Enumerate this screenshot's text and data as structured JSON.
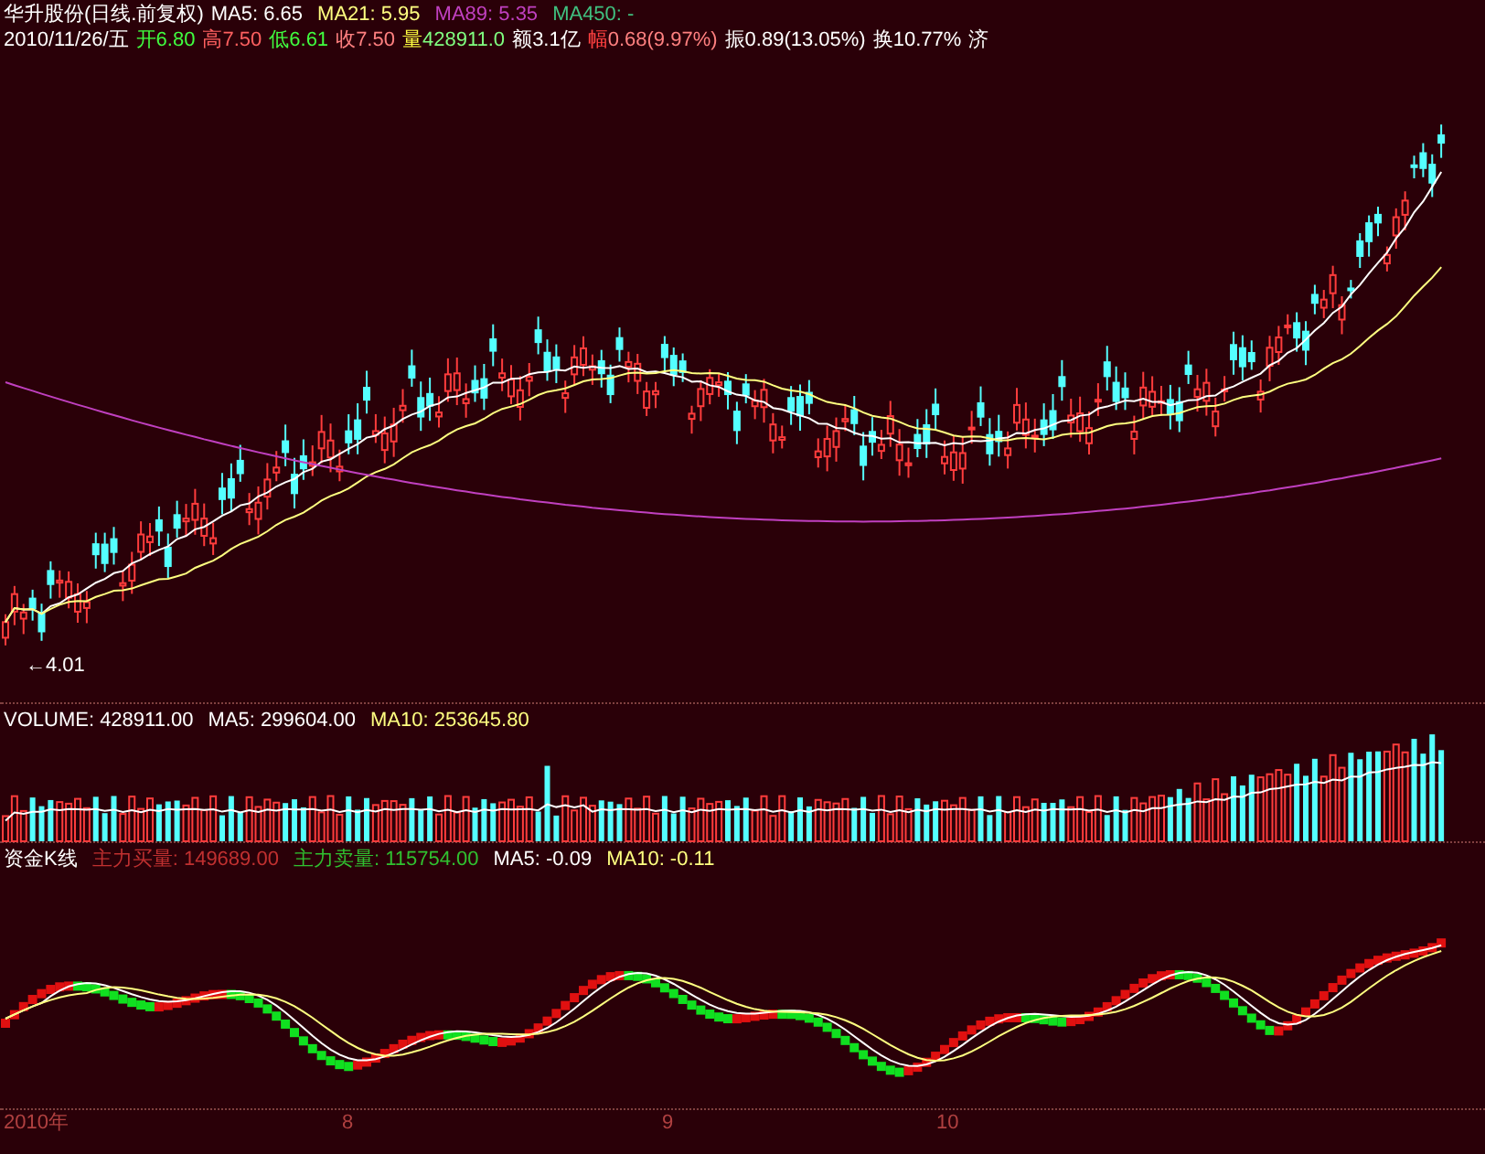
{
  "header": {
    "title": "华升股份(日线.前复权)",
    "indicators": [
      {
        "text": "MA5: 6.65",
        "color": "#ffffff"
      },
      {
        "text": "MA21: 5.95",
        "color": "#ffff80"
      },
      {
        "text": "MA89: 5.35",
        "color": "#c040c0"
      },
      {
        "text": "MA450: -",
        "color": "#40c080"
      }
    ]
  },
  "quote": {
    "date": "2010/11/26/五",
    "items": [
      {
        "label": {
          "text": "开",
          "color": "#40ff40"
        },
        "value": {
          "text": "6.80",
          "color": "#40ff40"
        }
      },
      {
        "label": {
          "text": "高",
          "color": "#ff6060"
        },
        "value": {
          "text": "7.50",
          "color": "#ff6060"
        }
      },
      {
        "label": {
          "text": "低",
          "color": "#40ff40"
        },
        "value": {
          "text": "6.61",
          "color": "#40ff40"
        }
      },
      {
        "label": {
          "text": "收",
          "color": "#ff8080"
        },
        "value": {
          "text": "7.50",
          "color": "#ff8080"
        }
      },
      {
        "label": {
          "text": "量",
          "color": "#ffff40"
        },
        "value": {
          "text": "428911.0",
          "color": "#80ff80"
        }
      },
      {
        "label": {
          "text": "额",
          "color": "#ffffff"
        },
        "value": {
          "text": "3.1亿",
          "color": "#ffffff"
        }
      },
      {
        "label": {
          "text": "幅",
          "color": "#ff4040"
        },
        "value": {
          "text": "0.68(9.97%)",
          "color": "#ff8080"
        }
      },
      {
        "label": {
          "text": "振",
          "color": "#ffffff"
        },
        "value": {
          "text": "0.89(13.05%)",
          "color": "#ffffff"
        }
      },
      {
        "label": {
          "text": "换",
          "color": "#ffffff"
        },
        "value": {
          "text": "10.77%",
          "color": "#ffffff"
        }
      },
      {
        "label": {
          "text": "济",
          "color": "#ffffff"
        }
      }
    ]
  },
  "price_chart": {
    "low_marker": "←4.01"
  },
  "volume": {
    "indicators": [
      {
        "text": "VOLUME: 428911.00",
        "color": "#ffffff"
      },
      {
        "text": "MA5: 299604.00",
        "color": "#ffffff"
      },
      {
        "text": "MA10: 253645.80",
        "color": "#ffff80"
      }
    ]
  },
  "fund": {
    "title": "资金K线",
    "indicators": [
      {
        "text": "主力买量: 149689.00",
        "color": "#c03030"
      },
      {
        "text": "主力卖量: 115754.00",
        "color": "#30c030"
      },
      {
        "text": "MA5: -0.09",
        "color": "#ffffff"
      },
      {
        "text": "MA10: -0.11",
        "color": "#ffff80"
      }
    ]
  },
  "x_axis": [
    "2010年",
    "8",
    "9",
    "10"
  ]
}
